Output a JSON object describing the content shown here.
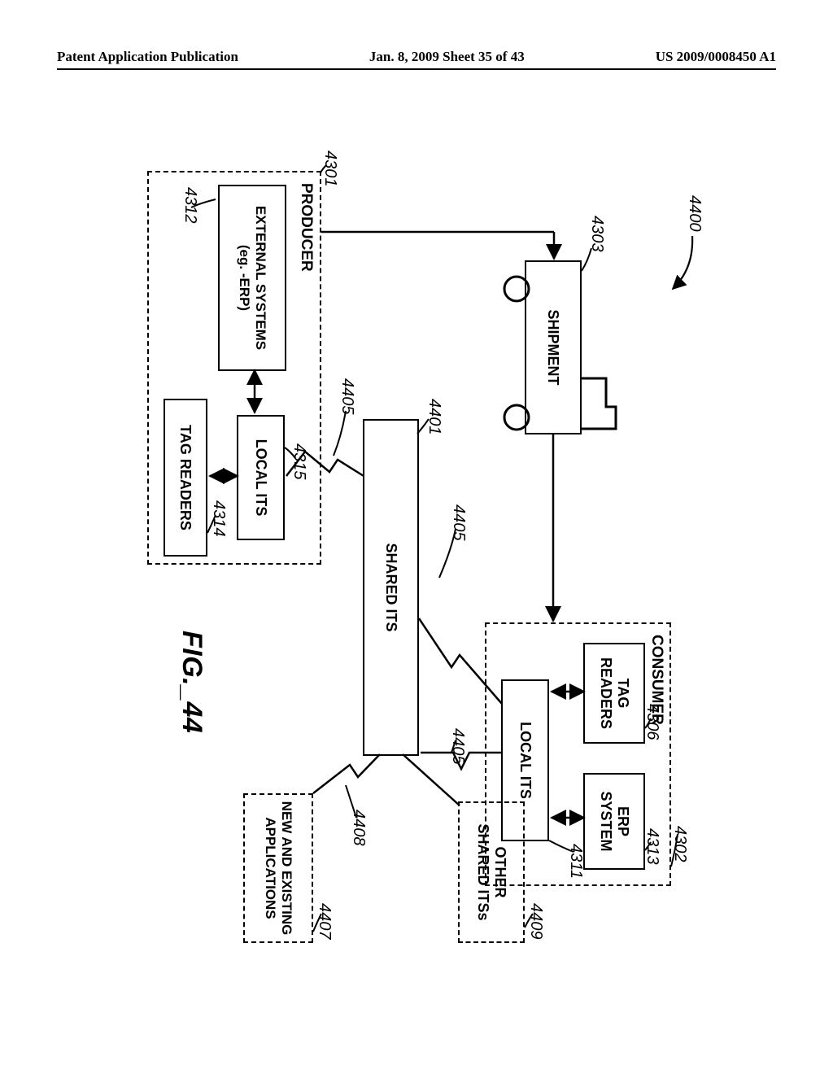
{
  "header": {
    "left": "Patent Application Publication",
    "center": "Jan. 8, 2009  Sheet 35 of 43",
    "right": "US 2009/0008450 A1"
  },
  "refs": {
    "r4400": "4400",
    "r4301": "4301",
    "r4302": "4302",
    "r4303": "4303",
    "r4306": "4306",
    "r4311": "4311",
    "r4312": "4312",
    "r4313": "4313",
    "r4314": "4314",
    "r4315": "4315",
    "r4401": "4401",
    "r4405a": "4405",
    "r4405b": "4405",
    "r4405c": "4405",
    "r4407": "4407",
    "r4408": "4408",
    "r4409": "4409"
  },
  "labels": {
    "producer": "PRODUCER",
    "consumer": "CONSUMER",
    "shipment": "SHIPMENT",
    "shared_its": "SHARED ITS",
    "local_its_p": "LOCAL ITS",
    "local_its_c": "LOCAL ITS",
    "tag_readers_p": "TAG READERS",
    "tag_readers_c": "TAG\nREADERS",
    "ext_systems": "EXTERNAL SYSTEMS\n(eg. -ERP)",
    "erp_system": "ERP\nSYSTEM",
    "other_shared_its": "OTHER\nSHARED ITSs",
    "new_existing_apps": "NEW AND EXISTING\nAPPLICATIONS"
  },
  "figure_caption": "FIG._44"
}
